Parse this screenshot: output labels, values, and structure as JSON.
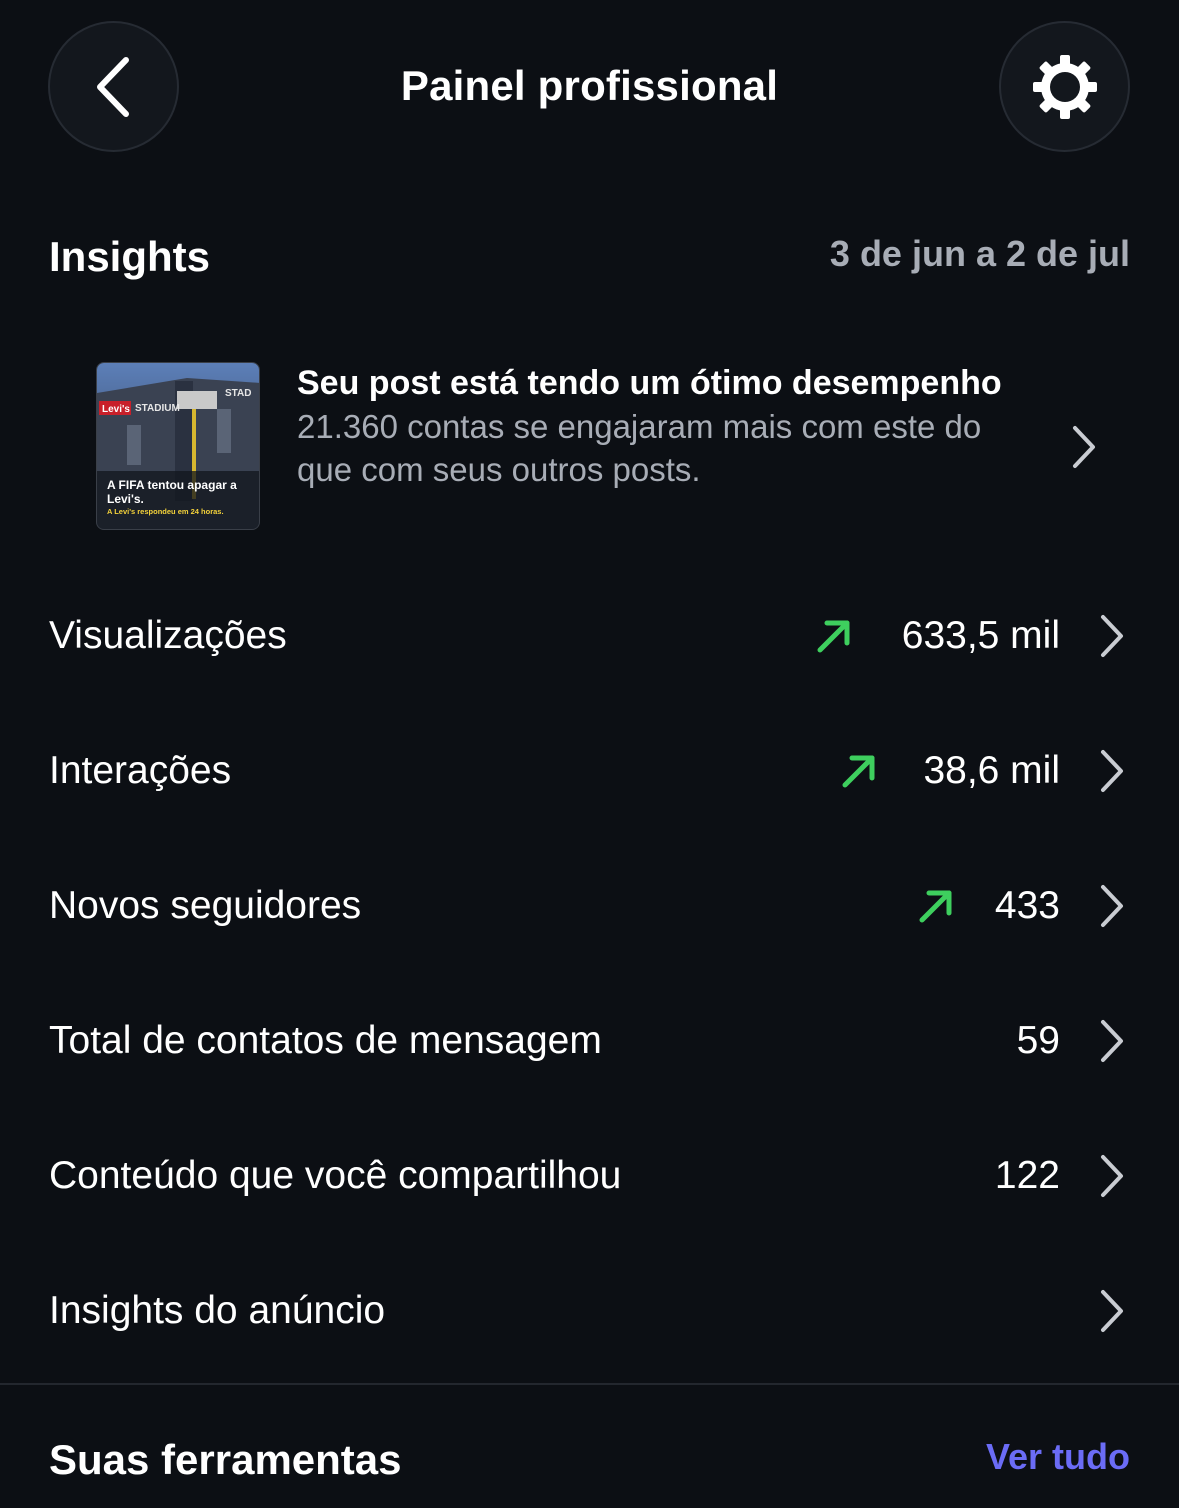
{
  "header": {
    "title": "Painel profissional",
    "back_icon": "chevron-left-icon",
    "settings_icon": "gear-icon"
  },
  "insights": {
    "title": "Insights",
    "date_range": "3 de jun a 2 de jul",
    "highlight": {
      "thumbnail": {
        "headline": "A FIFA tentou apagar a Levi's.",
        "sub": "A Levi's respondeu em 24 horas.",
        "sign_text": "Levi's",
        "stadium_text": "STADIUM",
        "stadium_text_2": "STAD"
      },
      "title": "Seu post está tendo um ótimo desempenho",
      "description": "21.360 contas se engajaram mais com este do que com seus outros posts."
    },
    "metrics": [
      {
        "label": "Visualizações",
        "value": "633,5 mil",
        "trend": "up"
      },
      {
        "label": "Interações",
        "value": "38,6 mil",
        "trend": "up"
      },
      {
        "label": "Novos seguidores",
        "value": "433",
        "trend": "up"
      },
      {
        "label": "Total de contatos de mensagem",
        "value": "59",
        "trend": ""
      },
      {
        "label": "Conteúdo que você compartilhou",
        "value": "122",
        "trend": ""
      },
      {
        "label": "Insights do anúncio",
        "value": "",
        "trend": ""
      }
    ]
  },
  "tools": {
    "title": "Suas ferramentas",
    "see_all": "Ver tudo"
  },
  "colors": {
    "background": "#0c0f14",
    "trend_up": "#3ecf5e",
    "link": "#6b6cf6",
    "secondary_text": "#a8adb6"
  }
}
